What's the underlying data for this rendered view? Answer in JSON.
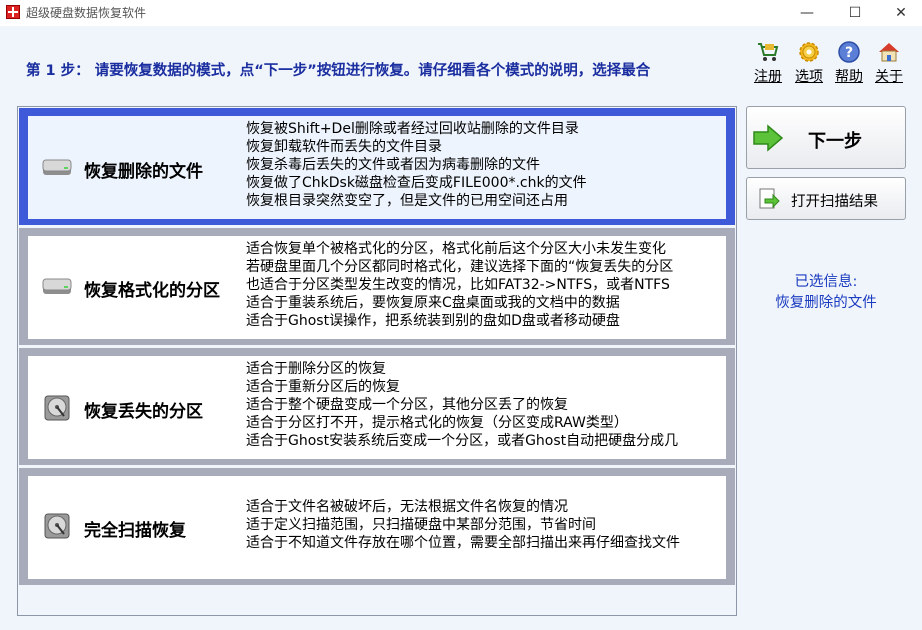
{
  "window": {
    "title": "超级硬盘数据恢复软件",
    "controls": [
      "—",
      "☐",
      "✕"
    ]
  },
  "header": {
    "step_text": "第 1 步： 请要恢复数据的模式，点“下一步”按钮进行恢复。请仔细看各个模式的说明，选择最合"
  },
  "toolbar": [
    {
      "id": "register",
      "label": "注册",
      "icon": "cart-icon"
    },
    {
      "id": "options",
      "label": "选项",
      "icon": "gear-icon"
    },
    {
      "id": "help",
      "label": "帮助",
      "icon": "help-icon"
    },
    {
      "id": "about",
      "label": "关于",
      "icon": "house-icon"
    }
  ],
  "modes": [
    {
      "id": "deleted",
      "title": "恢复删除的文件",
      "selected": true,
      "lines": [
        "恢复被Shift+Del删除或者经过回收站删除的文件目录",
        "恢复卸载软件而丢失的文件目录",
        "恢复杀毒后丢失的文件或者因为病毒删除的文件",
        "恢复做了ChkDsk磁盘检查后变成FILE000*.chk的文件",
        "恢复根目录突然变空了，但是文件的已用空间还占用"
      ]
    },
    {
      "id": "formatted",
      "title": "恢复格式化的分区",
      "selected": false,
      "lines": [
        "适合恢复单个被格式化的分区，格式化前后这个分区大小未发生变化",
        "若硬盘里面几个分区都同时格式化，建议选择下面的“恢复丢失的分区",
        "也适合于分区类型发生改变的情况，比如FAT32->NTFS，或者NTFS",
        "适合于重装系统后，要恢复原来C盘桌面或我的文档中的数据",
        "适合于Ghost误操作，把系统装到别的盘如D盘或者移动硬盘"
      ]
    },
    {
      "id": "lost",
      "title": "恢复丢失的分区",
      "selected": false,
      "lines": [
        "适合于删除分区的恢复",
        "适合于重新分区后的恢复",
        "适合于整个硬盘变成一个分区，其他分区丢了的恢复",
        "适合于分区打不开，提示格式化的恢复（分区变成RAW类型）",
        "适合于Ghost安装系统后变成一个分区，或者Ghost自动把硬盘分成几"
      ]
    },
    {
      "id": "fullscan",
      "title": "完全扫描恢复",
      "selected": false,
      "lines": [
        "适合于文件名被破坏后，无法根据文件名恢复的情况",
        "适于定义扫描范围，只扫描硬盘中某部分范围，节省时间",
        "适合于不知道文件存放在哪个位置，需要全部扫描出来再仔细查找文件"
      ]
    }
  ],
  "actions": {
    "next_label": "下一步",
    "open_scan_label": "打开扫描结果"
  },
  "selection_info": {
    "heading": "已选信息:",
    "value": "恢复删除的文件"
  },
  "colors": {
    "accent_text": "#1a2ea0",
    "selected_border": "#3f5ad8",
    "mode_border": "#a7abba",
    "info_text": "#1a3cc0"
  }
}
